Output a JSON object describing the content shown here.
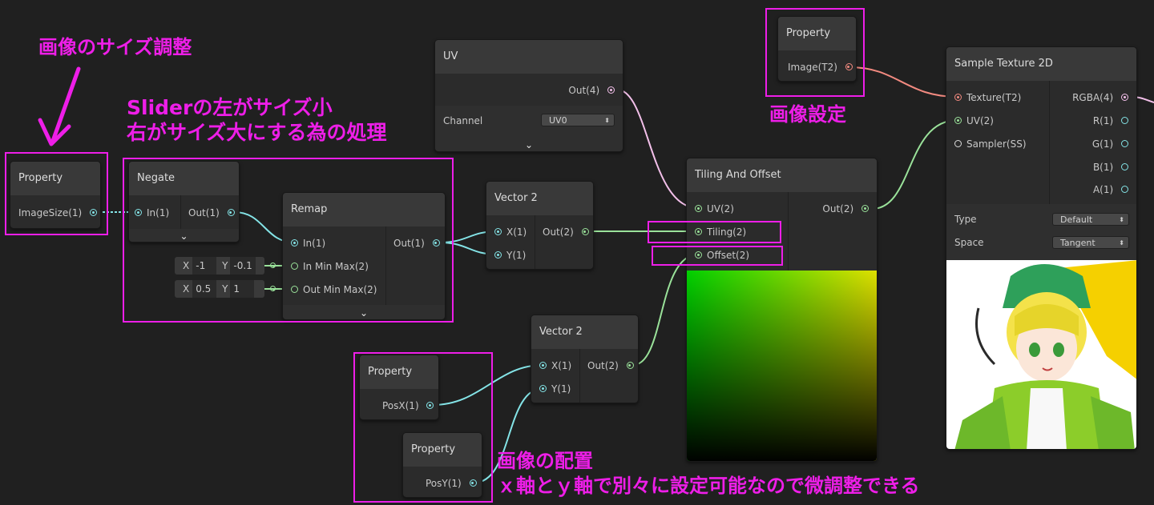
{
  "colors": {
    "annotation": "#ee1ee8",
    "wire_float": "#84e4e7",
    "wire_vector2": "#9ae29a",
    "wire_texture": "#f28a80",
    "wire_uv": "#f3c0ea"
  },
  "annotations": {
    "image_size": "画像のサイズ調整",
    "slider_line1": "Sliderの左がサイズ小",
    "slider_line2": "右がサイズ大にする為の処理",
    "image_setting": "画像設定",
    "placement_line1": "画像の配置",
    "placement_line2": "ｘ軸とｙ軸で別々に設定可能なので微調整できる"
  },
  "nodes": {
    "prop_image_size": {
      "title": "Property",
      "out": "ImageSize(1)"
    },
    "negate": {
      "title": "Negate",
      "in": "In(1)",
      "out": "Out(1)"
    },
    "remap": {
      "title": "Remap",
      "inputs": [
        "In(1)",
        "In Min Max(2)",
        "Out Min Max(2)"
      ],
      "out": "Out(1)",
      "in_min_max": {
        "x_label": "X",
        "x": "-1",
        "y_label": "Y",
        "y": "-0.1"
      },
      "out_min_max": {
        "x_label": "X",
        "x": "0.5",
        "y_label": "Y",
        "y": "1"
      }
    },
    "uv": {
      "title": "UV",
      "out": "Out(4)",
      "channel_label": "Channel",
      "channel_value": "UV0"
    },
    "vector2_a": {
      "title": "Vector 2",
      "inputs": [
        "X(1)",
        "Y(1)"
      ],
      "out": "Out(2)"
    },
    "vector2_b": {
      "title": "Vector 2",
      "inputs": [
        "X(1)",
        "Y(1)"
      ],
      "out": "Out(2)"
    },
    "tiling_offset": {
      "title": "Tiling And Offset",
      "inputs": [
        "UV(2)",
        "Tiling(2)",
        "Offset(2)"
      ],
      "out": "Out(2)"
    },
    "prop_image": {
      "title": "Property",
      "out": "Image(T2)"
    },
    "sample_texture": {
      "title": "Sample Texture 2D",
      "inputs": [
        "Texture(T2)",
        "UV(2)",
        "Sampler(SS)"
      ],
      "outputs": [
        "RGBA(4)",
        "R(1)",
        "G(1)",
        "B(1)",
        "A(1)"
      ],
      "type_label": "Type",
      "type_value": "Default",
      "space_label": "Space",
      "space_value": "Tangent"
    },
    "prop_posx": {
      "title": "Property",
      "out": "PosX(1)"
    },
    "prop_posy": {
      "title": "Property",
      "out": "PosY(1)"
    }
  }
}
